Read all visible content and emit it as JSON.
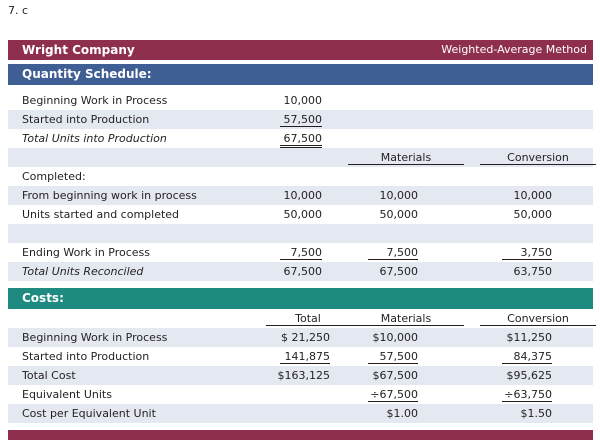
{
  "question_number": "7. c",
  "header": {
    "company": "Wright Company",
    "method": "Weighted-Average Method"
  },
  "quantity": {
    "section_label": "Quantity Schedule:",
    "beginning_wip": {
      "label": "Beginning Work in Process",
      "value": "10,000"
    },
    "started": {
      "label": "Started into Production",
      "value": "57,500"
    },
    "total_into": {
      "label": "Total Units into Production",
      "value": "67,500"
    },
    "col_materials": "Materials",
    "col_conversion": "Conversion",
    "completed_label": "Completed:",
    "from_beginning": {
      "label": "From beginning work in process",
      "total": "10,000",
      "materials": "10,000",
      "conversion": "10,000"
    },
    "started_completed": {
      "label": "Units started and completed",
      "total": "50,000",
      "materials": "50,000",
      "conversion": "50,000"
    },
    "ending_wip": {
      "label": "Ending Work in Process",
      "total": "7,500",
      "materials": "7,500",
      "conversion": "3,750"
    },
    "total_reconciled": {
      "label": "Total Units Reconciled",
      "total": "67,500",
      "materials": "67,500",
      "conversion": "63,750"
    }
  },
  "costs": {
    "section_label": "Costs:",
    "col_total": "Total",
    "col_materials": "Materials",
    "col_conversion": "Conversion",
    "beginning_wip": {
      "label": "Beginning Work in Process",
      "total": "$ 21,250",
      "materials": "$10,000",
      "conversion": "$11,250"
    },
    "started": {
      "label": "Started into Production",
      "total": "141,875",
      "materials": "57,500",
      "conversion": "84,375"
    },
    "total_cost": {
      "label": "Total Cost",
      "total": "$163,125",
      "materials": "$67,500",
      "conversion": "$95,625"
    },
    "equivalent_units": {
      "label": "Equivalent Units",
      "materials": "÷67,500",
      "conversion": "÷63,750"
    },
    "cost_per_unit": {
      "label": "Cost per Equivalent Unit",
      "materials": "$1.00",
      "conversion": "$1.50"
    }
  },
  "colors": {
    "title_band": "#8f2f4e",
    "quantity_band": "#3f5e93",
    "costs_band": "#1f8a80",
    "row_shade": "#e4e8f1"
  }
}
